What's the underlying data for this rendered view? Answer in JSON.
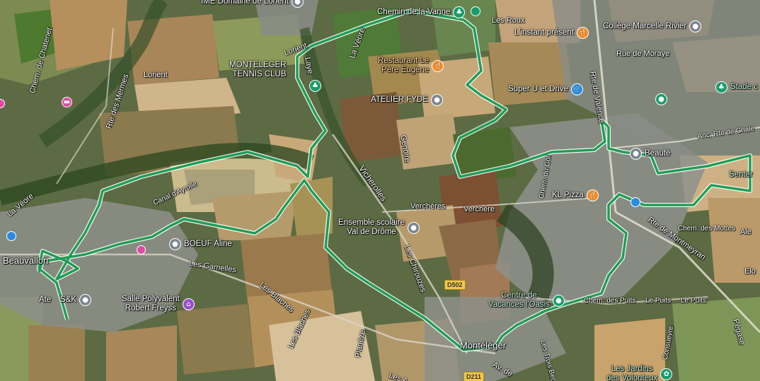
{
  "places": {
    "beauvallon": "Beauvallon",
    "monteleger": "Montéléger"
  },
  "pois": {
    "ime": "IME Domaine de Lorient",
    "tennis": "MONTELEGER\nTENNIS CLUB",
    "restaurant": "Restaurant Le\nPère Eugène",
    "atelier_fyde": "ATELIER FYDE",
    "chem": "Chemin de la Vanne",
    "instant": "L'instant présent",
    "college": "Collège Marcelle Rivier",
    "superu": "Super U et Drive",
    "stade": "Stade c",
    "beaute": "Beauté",
    "kl_pizza": "KL Pizza",
    "ensemble": "Ensemble scolaire\nVal de Drôme",
    "boeuf": "BOEUF Aline",
    "atelier_sk": "Ate    S&K",
    "salle": "Salle Polyvalent\nRobert Freyss",
    "centre": "Centre de\nVacances l'Oasis",
    "jardins": "Les Jardins\ndes Volonteux",
    "senter": "Senter"
  },
  "roads": {
    "chatenet": "Chem. de Chatenet",
    "lorient1": "Lorient",
    "lorient2": "Lorient",
    "mermes": "Rte des Mermes",
    "laye": "Laye",
    "la_veore1": "La Véore",
    "la_veore2": "La Véore",
    "genoire": "Genoire",
    "vicherolles": "Vicherolles",
    "verchere1": "Verchères",
    "verchere2": "Verchère",
    "chiroures": "Les Chirouzes",
    "gamelles": "Les Gamelles",
    "blaches1": "Les Blaches",
    "blaches2": "Les Blaches",
    "planeze": "Planèze",
    "roux": "Les Roux",
    "moraye": "Rue de Moraye",
    "valence": "Rte de Valence",
    "chalet": "Anc. Rte de Chale",
    "montmeyran": "Rte de Montmeyran",
    "mottes": "Chem. des Mottes",
    "puits1": "Chem. des Puits",
    "puits2": "Le Puits",
    "puits3": "Le Puits",
    "trois_becs": "Les Trois Becs",
    "pegase": "Pégase",
    "consuevre": "Consuevre",
    "av": "Av. de",
    "les_a": "Les A",
    "canal": "Canal d'Ayrolle",
    "chem_du_col": "Chem. du Col",
    "elo": "Elo",
    "ale": "Ale"
  },
  "shields": {
    "d502": "D502",
    "d211": "D211"
  },
  "icons": {
    "grey": "pin-grey-icon",
    "orange": "restaurant-icon",
    "green": "park-icon",
    "blue": "shopping-icon",
    "purple": "venue-icon",
    "pink": "hotel-icon"
  },
  "colors": {
    "route": "#1f9d55"
  }
}
